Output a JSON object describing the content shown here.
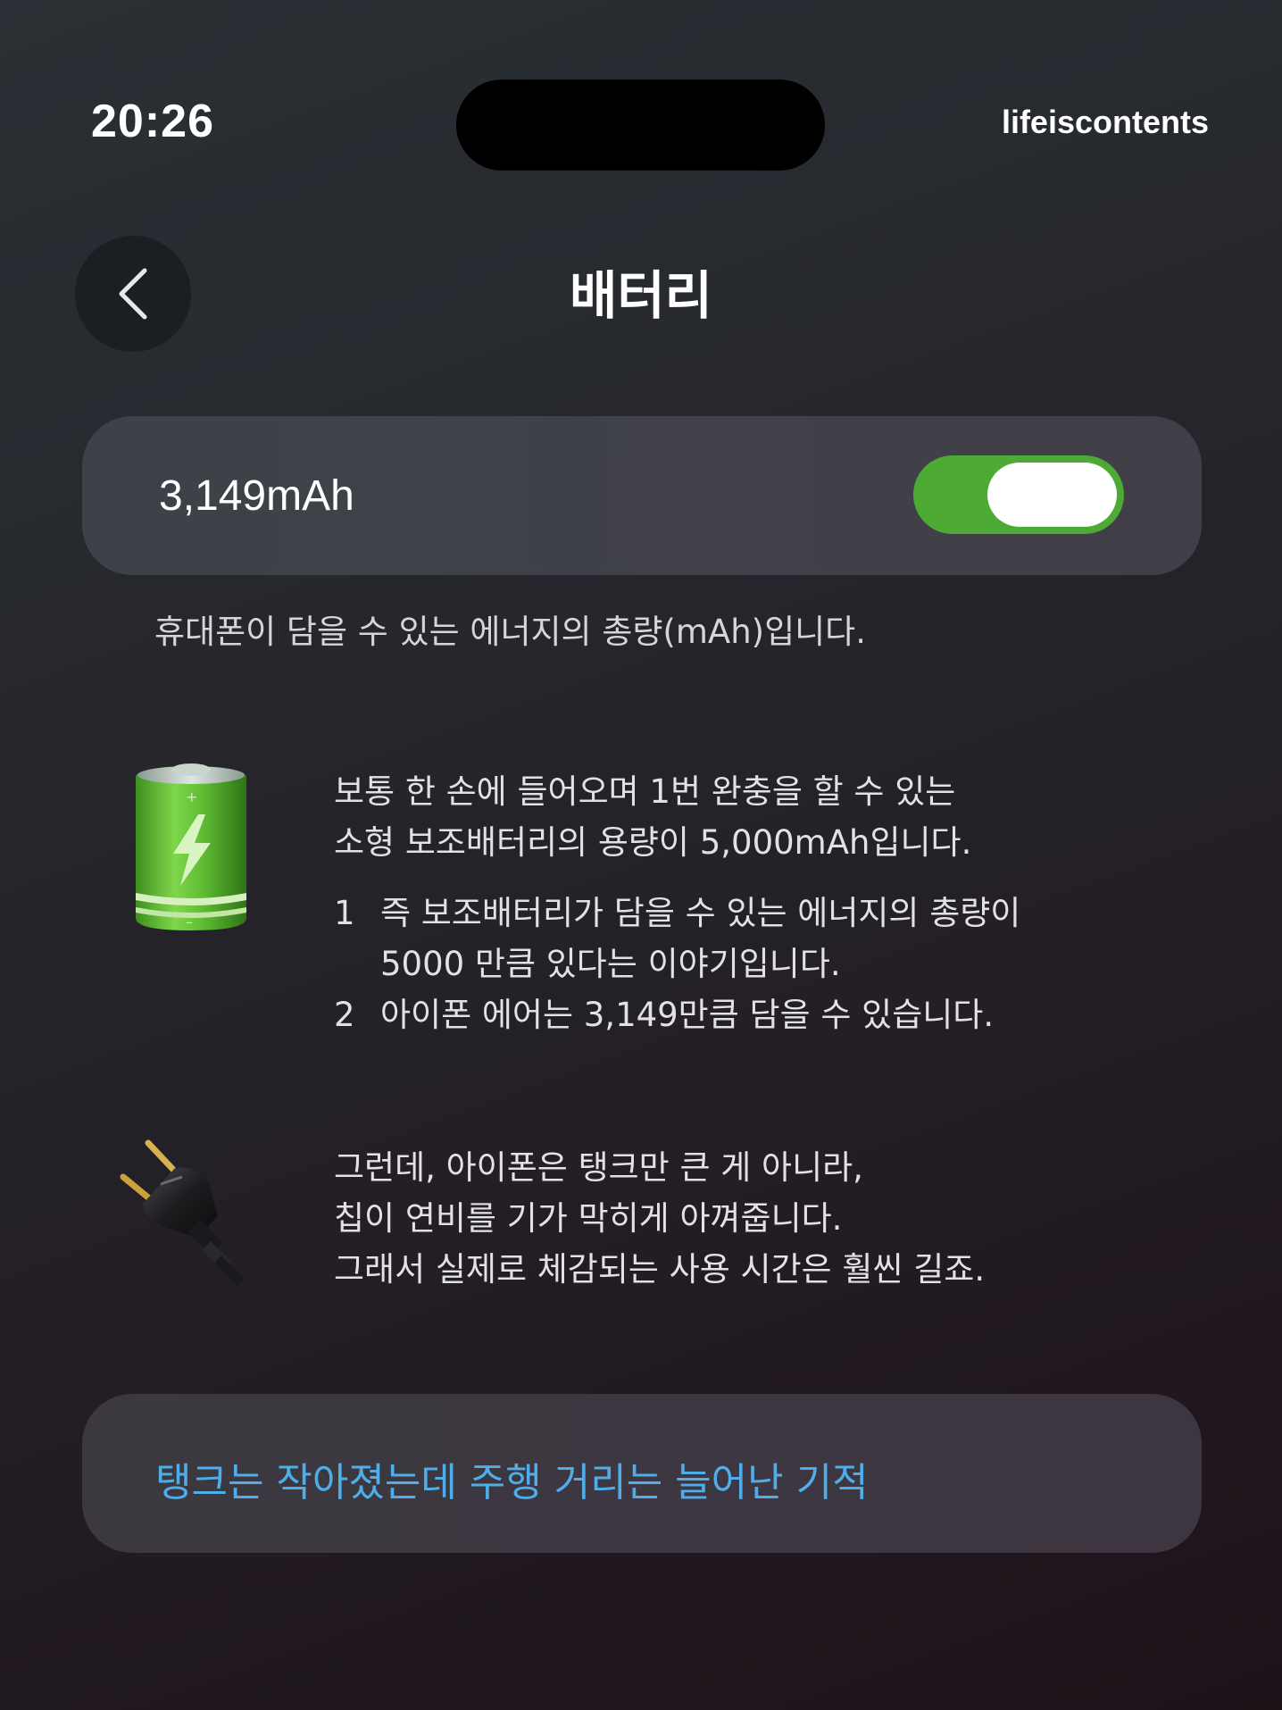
{
  "status_bar": {
    "time": "20:26",
    "brand": "lifeiscontents"
  },
  "nav": {
    "title": "배터리",
    "back_icon": "chevron-left-icon"
  },
  "capacity": {
    "value": "3,149mAh",
    "toggle_on": true,
    "toggle_color": "#4caa35",
    "caption": "휴대폰이 담을 수 있는 에너지의 총량(mAh)입니다."
  },
  "battery_section": {
    "icon": "battery-icon",
    "lines": [
      "보통 한 손에 들어오며 1번 완충을 할 수 있는",
      "소형 보조배터리의 용량이 5,000mAh입니다."
    ],
    "list": [
      {
        "num": "1",
        "lines": [
          "즉 보조배터리가 담을 수 있는 에너지의 총량이",
          "5000 만큼 있다는 이야기입니다."
        ]
      },
      {
        "num": "2",
        "lines": [
          "아이폰 에어는 3,149만큼 담을 수 있습니다."
        ]
      }
    ]
  },
  "plug_section": {
    "icon": "plug-icon",
    "lines": [
      "그런데, 아이폰은 탱크만 큰 게 아니라,",
      "칩이 연비를 기가 막히게 아껴줍니다.",
      "그래서 실제로 체감되는 사용 시간은 훨씬 길죠."
    ]
  },
  "link_card": {
    "text": "탱크는 작아졌는데 주행 거리는 늘어난 기적",
    "color": "#4faee9"
  }
}
